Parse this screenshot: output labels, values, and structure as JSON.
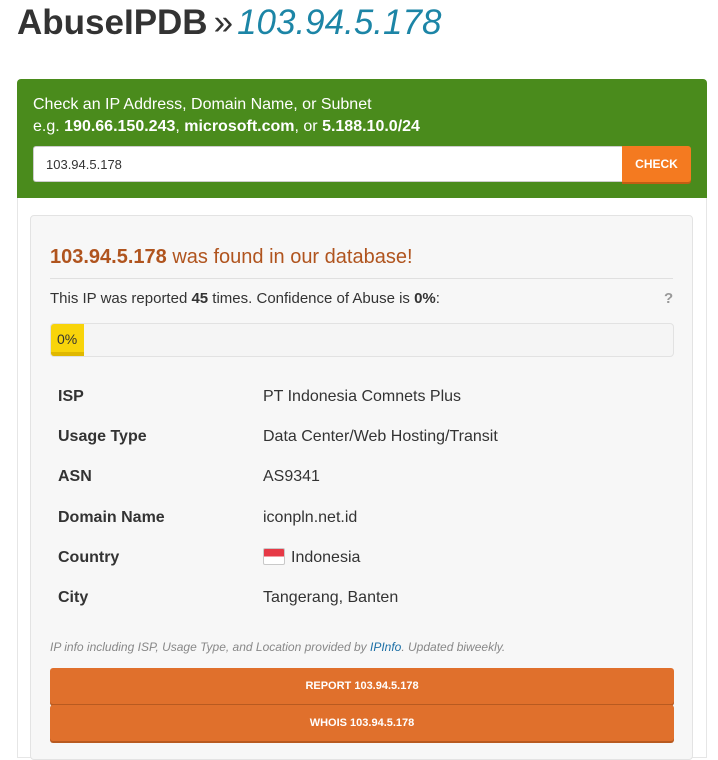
{
  "header": {
    "brand": "AbuseIPDB",
    "separator": "»",
    "ip": "103.94.5.178"
  },
  "check_panel": {
    "line1": "Check an IP Address, Domain Name, or Subnet",
    "example_prefix": "e.g. ",
    "example_ip": "190.66.150.243",
    "example_comma": ", ",
    "example_domain": "microsoft.com",
    "example_or": ", or ",
    "example_subnet": "5.188.10.0/24",
    "input_value": "103.94.5.178",
    "button_label": "CHECK"
  },
  "result": {
    "found_ip": "103.94.5.178",
    "found_suffix": " was found in our database!",
    "summary_prefix": "This IP was reported ",
    "report_count": "45",
    "summary_middle": " times. Confidence of Abuse is ",
    "confidence": "0%",
    "summary_suffix": ":",
    "help": "?",
    "confidence_fraction": 0,
    "progress_label": "0%"
  },
  "info_rows": [
    {
      "key": "ISP",
      "value": "PT Indonesia Comnets Plus"
    },
    {
      "key": "Usage Type",
      "value": "Data Center/Web Hosting/Transit"
    },
    {
      "key": "ASN",
      "value": "AS9341"
    },
    {
      "key": "Domain Name",
      "value": "iconpln.net.id"
    },
    {
      "key": "Country",
      "value": "Indonesia",
      "icon": "indonesia-flag-icon"
    },
    {
      "key": "City",
      "value": "Tangerang, Banten"
    }
  ],
  "attribution": {
    "prefix": "IP info including ISP, Usage Type, and Location provided by ",
    "link": "IPInfo",
    "suffix": ". Updated biweekly."
  },
  "actions": {
    "report_label": "REPORT 103.94.5.178",
    "whois_label": "WHOIS 103.94.5.178"
  },
  "colors": {
    "panel_green": "#4a8b1c",
    "check_orange": "#f47a20",
    "action_orange": "#e0702c",
    "header_ip_blue": "#1c85a6",
    "found_text": "#b0541e",
    "progress_yellow": "#f8d40a"
  }
}
